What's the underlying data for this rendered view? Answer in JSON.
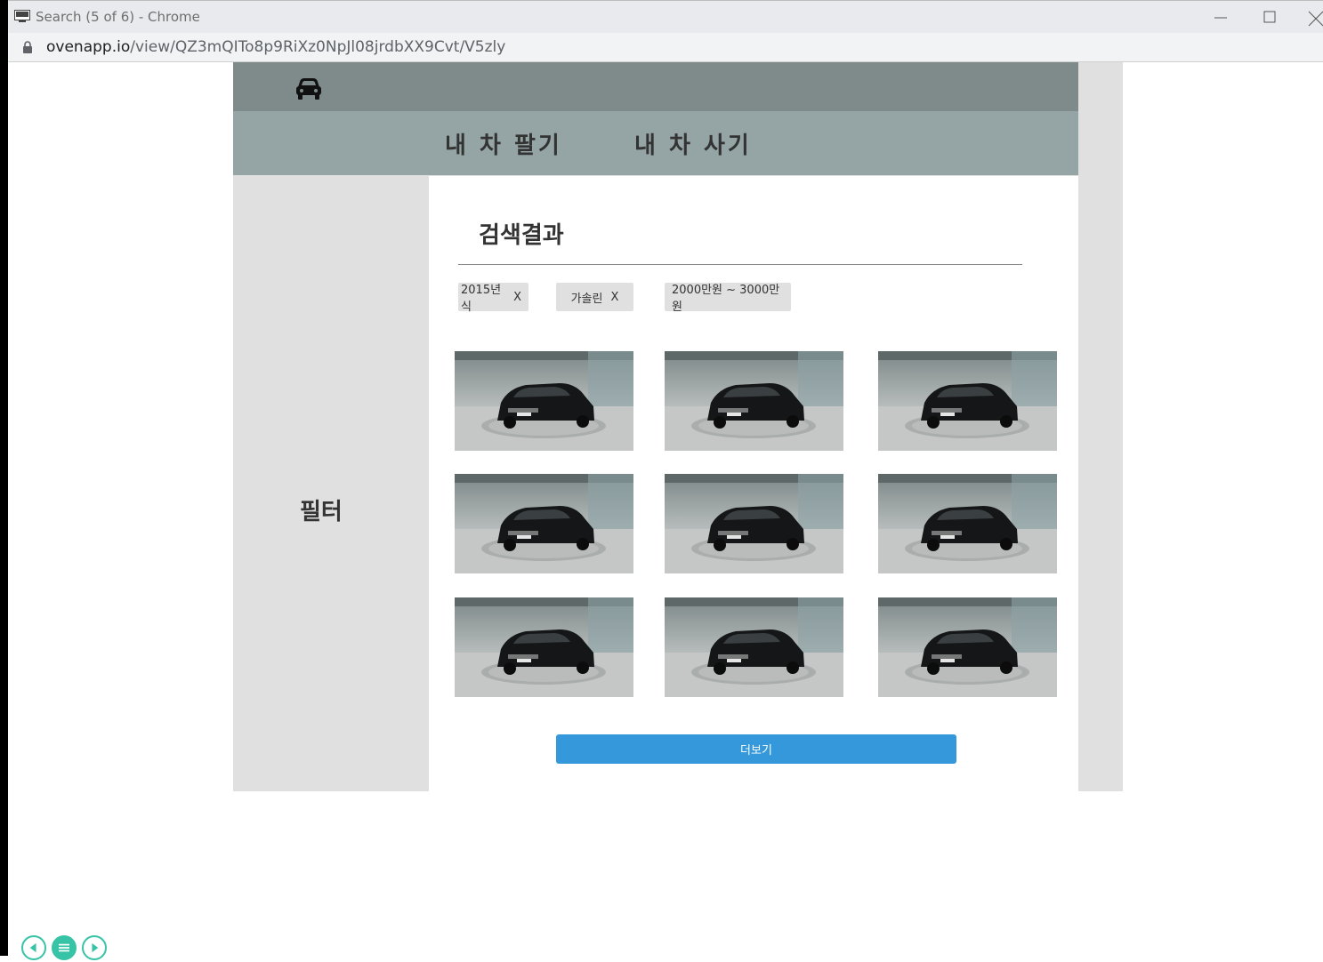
{
  "window": {
    "title": "Search  (5 of 6) - Chrome",
    "url_host": "ovenapp.io",
    "url_path": "/view/QZ3mQITo8p9RiXz0NpJl08jrdbXX9Cvt/V5zly"
  },
  "header": {
    "logo_icon": "car-icon"
  },
  "nav": {
    "sell_label": "내 차 팔기",
    "buy_label": "내 차 사기"
  },
  "sidebar": {
    "filter_label": "필터"
  },
  "results": {
    "title": "검색결과",
    "chips": [
      {
        "label": "2015년식",
        "remove": "X"
      },
      {
        "label": "가솔린",
        "remove": "X"
      },
      {
        "label": "2000만원 ~ 3000만원"
      }
    ],
    "car_count": 9,
    "more_label": "더보기"
  },
  "colors": {
    "header": "#7f8b8b",
    "nav": "#95a5a5",
    "sidebar": "#e0e0e0",
    "button": "#3498db",
    "controls": "#36c3a6"
  }
}
